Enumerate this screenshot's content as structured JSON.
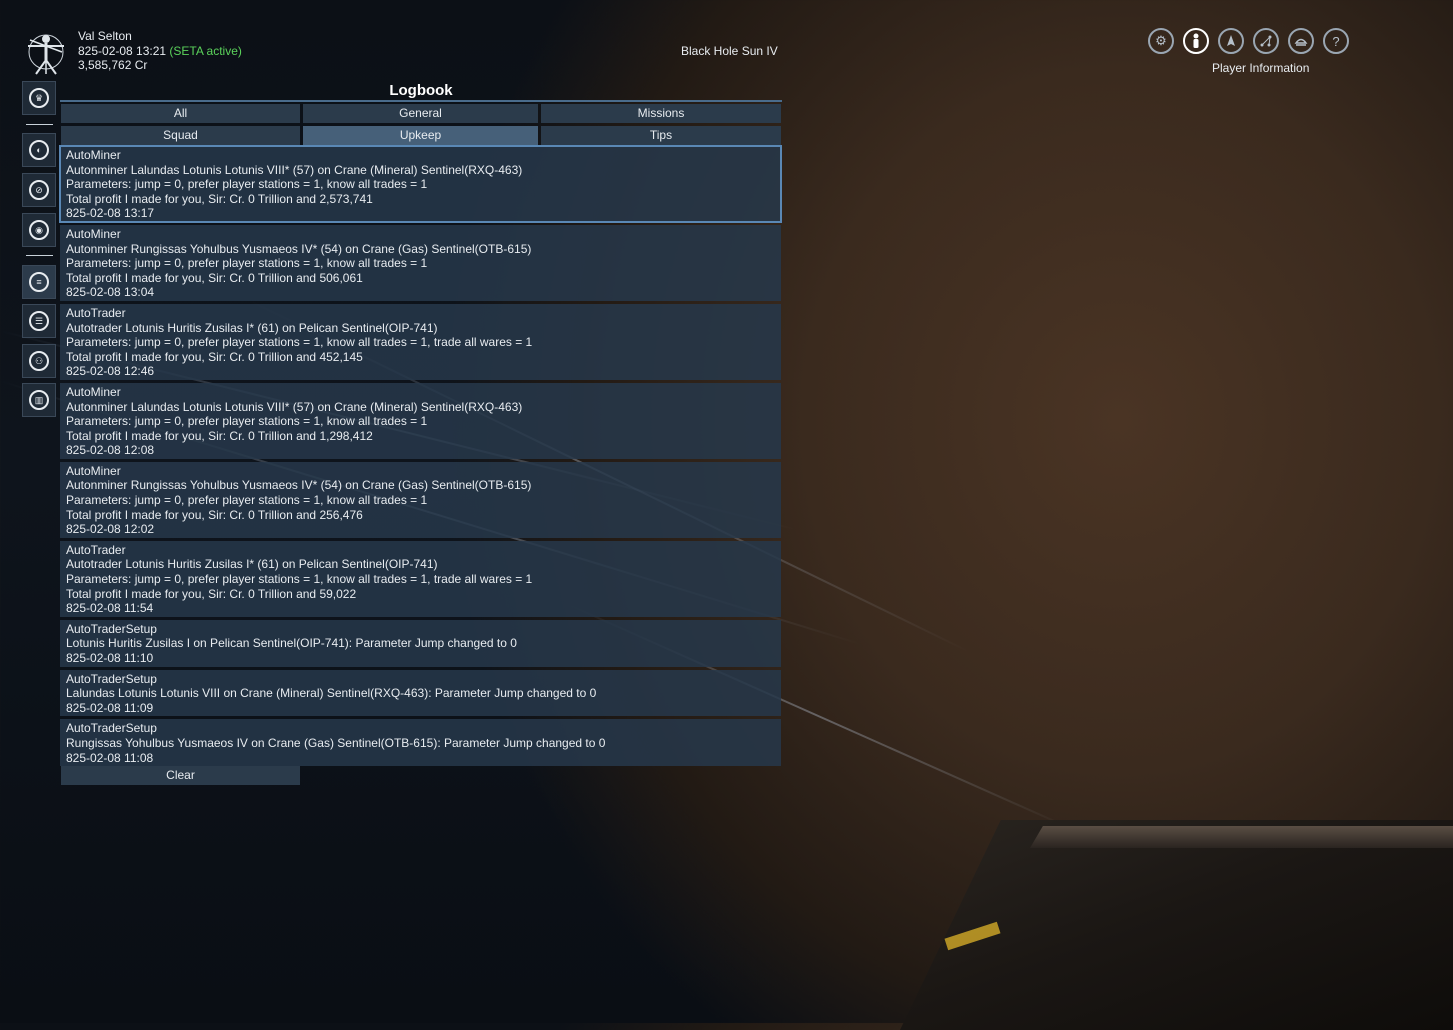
{
  "player": {
    "name": "Val Selton",
    "date": "825-02-08 13:21",
    "seta": "(SETA active)",
    "credits": "3,585,762 Cr"
  },
  "sector": "Black Hole Sun IV",
  "top_menu": {
    "active_label": "Player Information",
    "icons": [
      "gear-icon",
      "player-icon",
      "ship-icon",
      "map-icon",
      "encyclopedia-icon",
      "help-icon"
    ]
  },
  "side_menu": {
    "icons": [
      "crown-icon",
      "globe-icon",
      "compass-icon",
      "faction-icon",
      "logbook-icon",
      "options-icon",
      "personnel-icon",
      "stats-icon"
    ]
  },
  "logbook": {
    "title": "Logbook",
    "tabs": [
      {
        "label": "All"
      },
      {
        "label": "General"
      },
      {
        "label": "Missions"
      },
      {
        "label": "Squad"
      },
      {
        "label": "Upkeep"
      },
      {
        "label": "Tips"
      }
    ],
    "selected_tab": "Upkeep",
    "entries": [
      {
        "title": "AutoMiner",
        "lines": [
          "Autonminer Lalundas Lotunis Lotunis VIII* (57) on Crane (Mineral) Sentinel(RXQ-463)",
          " Parameters: jump = 0, prefer player stations = 1, know all trades = 1",
          " Total profit I made for you, Sir: Cr.  0 Trillion and  2,573,741"
        ],
        "time": "825-02-08 13:17"
      },
      {
        "title": "AutoMiner",
        "lines": [
          "Autonminer Rungissas Yohulbus Yusmaeos IV* (54) on Crane (Gas) Sentinel(OTB-615)",
          " Parameters: jump = 0, prefer player stations = 1, know all trades = 1",
          " Total profit I made for you, Sir: Cr.  0 Trillion and  506,061"
        ],
        "time": "825-02-08 13:04"
      },
      {
        "title": "AutoTrader",
        "lines": [
          "Autotrader Lotunis Huritis Zusilas I* (61) on Pelican Sentinel(OIP-741)",
          " Parameters: jump = 0, prefer player stations = 1, know all trades = 1, trade all wares = 1",
          " Total profit I made for you, Sir: Cr.  0 Trillion and  452,145"
        ],
        "time": "825-02-08 12:46"
      },
      {
        "title": "AutoMiner",
        "lines": [
          "Autonminer Lalundas Lotunis Lotunis VIII* (57) on Crane (Mineral) Sentinel(RXQ-463)",
          " Parameters: jump = 0, prefer player stations = 1, know all trades = 1",
          " Total profit I made for you, Sir: Cr.  0 Trillion and  1,298,412"
        ],
        "time": "825-02-08 12:08"
      },
      {
        "title": "AutoMiner",
        "lines": [
          "Autonminer Rungissas Yohulbus Yusmaeos IV* (54) on Crane (Gas) Sentinel(OTB-615)",
          " Parameters: jump = 0, prefer player stations = 1, know all trades = 1",
          " Total profit I made for you, Sir: Cr.  0 Trillion and  256,476"
        ],
        "time": "825-02-08 12:02"
      },
      {
        "title": "AutoTrader",
        "lines": [
          "Autotrader Lotunis Huritis Zusilas I* (61) on Pelican Sentinel(OIP-741)",
          " Parameters: jump = 0, prefer player stations = 1, know all trades = 1, trade all wares = 1",
          " Total profit I made for you, Sir: Cr.  0 Trillion and  59,022"
        ],
        "time": "825-02-08 11:54"
      },
      {
        "title": "AutoTraderSetup",
        "lines": [
          "Lotunis Huritis Zusilas I on Pelican Sentinel(OIP-741): Parameter Jump changed to 0"
        ],
        "time": "825-02-08 11:10"
      },
      {
        "title": "AutoTraderSetup",
        "lines": [
          "Lalundas Lotunis Lotunis VIII on Crane (Mineral) Sentinel(RXQ-463): Parameter Jump changed to 0"
        ],
        "time": "825-02-08 11:09"
      },
      {
        "title": "AutoTraderSetup",
        "lines": [
          "Rungissas Yohulbus Yusmaeos IV on Crane (Gas) Sentinel(OTB-615): Parameter Jump changed to 0"
        ],
        "time": "825-02-08 11:08"
      }
    ],
    "clear_label": "Clear"
  }
}
